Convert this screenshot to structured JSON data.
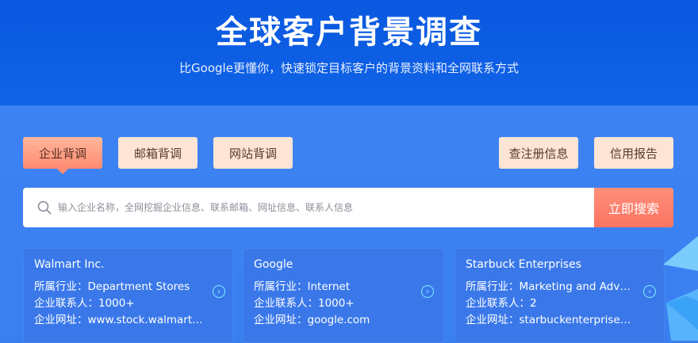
{
  "hero": {
    "title": "全球客户背景调查",
    "subtitle": "比Google更懂你，快速锁定目标客户的背景资料和全网联系方式"
  },
  "tabs": [
    {
      "label": "企业背调",
      "active": true
    },
    {
      "label": "邮箱背调",
      "active": false
    },
    {
      "label": "网站背调",
      "active": false
    }
  ],
  "actions": [
    {
      "label": "查注册信息"
    },
    {
      "label": "信用报告"
    }
  ],
  "search": {
    "placeholder": "输入企业名称，全网挖掘企业信息、联系邮箱、网址信息、联系人信息",
    "button_label": "立即搜索"
  },
  "cards": [
    {
      "name": "Walmart Inc.",
      "industry": "所属行业：Department Stores",
      "contacts": "企业联系人：1000+",
      "website": "企业网址：www.stock.walmart.com"
    },
    {
      "name": "Google",
      "industry": "所属行业：Internet",
      "contacts": "企业联系人：1000+",
      "website": "企业网址：google.com"
    },
    {
      "name": "Starbuck Enterprises",
      "industry": "所属行业：Marketing and Advertising",
      "contacts": "企业联系人：2",
      "website": "企业网址：starbuckenterprises.com"
    }
  ],
  "colors": {
    "hero_bg": "#0a58e0",
    "main_bg": "#3b80f0",
    "tab_active": "#ff8b73",
    "tab_inactive": "#fde4d4",
    "search_button": "#fb7462",
    "arrow_accent": "#7ff0ff"
  }
}
